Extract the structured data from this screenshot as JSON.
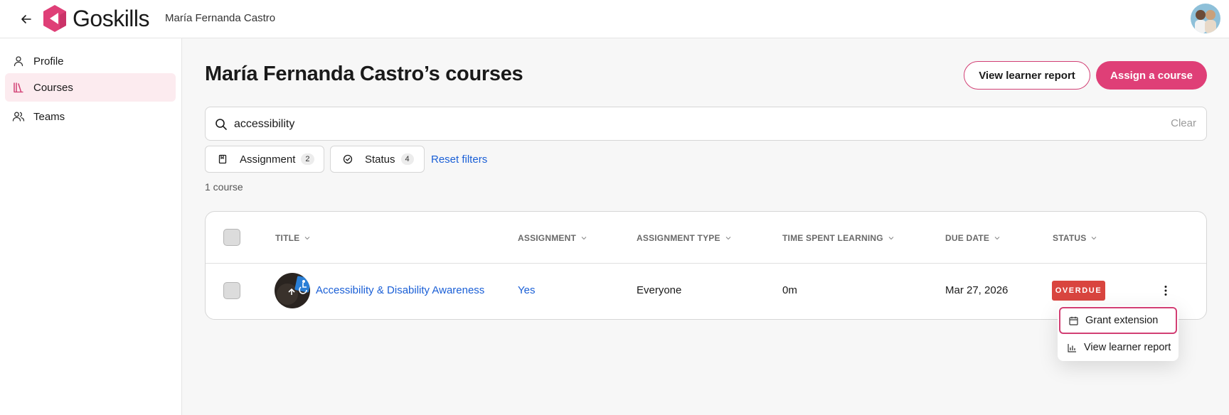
{
  "header": {
    "logo_text": "Goskills",
    "learner_name": "María Fernanda Castro"
  },
  "sidebar": {
    "items": [
      {
        "label": "Profile",
        "icon": "user-icon",
        "active": false
      },
      {
        "label": "Courses",
        "icon": "books-icon",
        "active": true
      },
      {
        "label": "Teams",
        "icon": "users-icon",
        "active": false
      }
    ]
  },
  "main": {
    "title": "María Fernanda Castro’s courses",
    "view_report_label": "View learner report",
    "assign_label": "Assign a course",
    "search": {
      "value": "accessibility",
      "clear_label": "Clear"
    },
    "filters": [
      {
        "label": "Assignment",
        "count": "2",
        "icon": "bookmark-icon"
      },
      {
        "label": "Status",
        "count": "4",
        "icon": "check-circle-icon"
      }
    ],
    "reset_label": "Reset filters",
    "course_count": "1 course"
  },
  "table": {
    "columns": [
      "TITLE",
      "ASSIGNMENT",
      "ASSIGNMENT TYPE",
      "TIME SPENT LEARNING",
      "DUE DATE",
      "STATUS"
    ],
    "rows": [
      {
        "title": "Accessibility & Disability Awareness",
        "assignment": "Yes",
        "assignment_type": "Everyone",
        "time_spent": "0m",
        "due_date": "Mar 27, 2026",
        "status": "OVERDUE"
      }
    ]
  },
  "row_menu": {
    "items": [
      {
        "label": "Grant extension",
        "icon": "calendar-icon"
      },
      {
        "label": "View learner report",
        "icon": "bar-chart-icon"
      }
    ]
  },
  "colors": {
    "brand": "#df3f77",
    "link": "#1a5fd6",
    "overdue": "#d9453f",
    "active_nav_bg": "#fcebef"
  }
}
